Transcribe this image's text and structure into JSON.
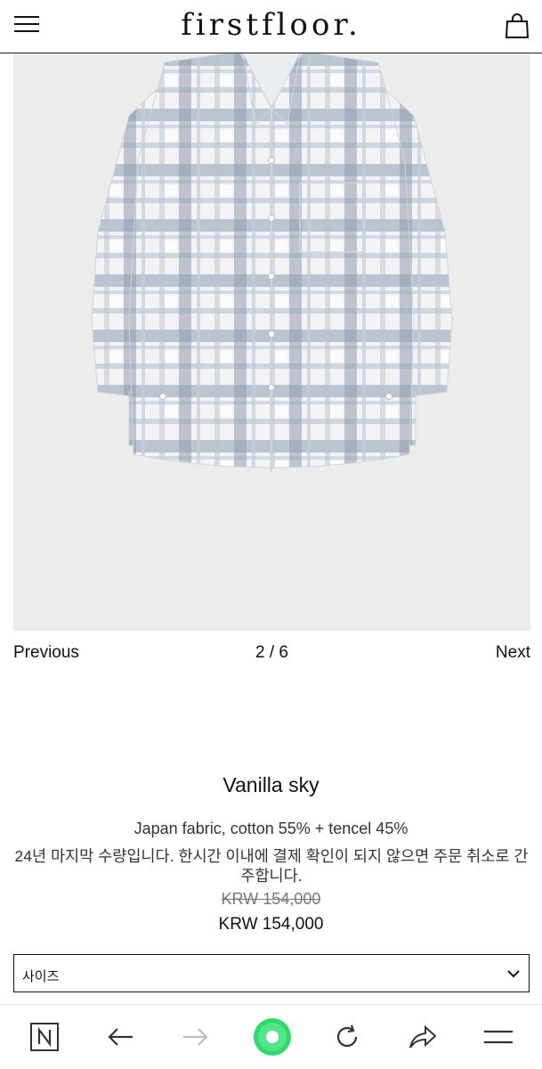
{
  "header": {
    "brand": "firstfloor.",
    "menu_icon": "hamburger-menu-icon",
    "bag_icon": "shopping-bag-icon"
  },
  "gallery": {
    "image_alt": "Vanilla sky check shirt",
    "previous_label": "Previous",
    "counter": "2 / 6",
    "next_label": "Next"
  },
  "product": {
    "name": "Vanilla sky",
    "description": "Japan fabric, cotton 55% + tencel 45%",
    "notice": "24년 마지막 수량입니다. 한시간 이내에 결제 확인이 되지 않으면 주문 취소로 간주합니다.",
    "price_original": "KRW 154,000",
    "price_current": "KRW 154,000"
  },
  "size_select": {
    "label": "사이즈",
    "icon": "chevron-down-icon"
  },
  "browser_bar": {
    "items": [
      "n-home-icon",
      "back-arrow-icon",
      "forward-arrow-icon",
      "green-dot-icon",
      "reload-icon",
      "share-icon",
      "menu-lines-icon"
    ],
    "accent": "#2fd96b"
  }
}
